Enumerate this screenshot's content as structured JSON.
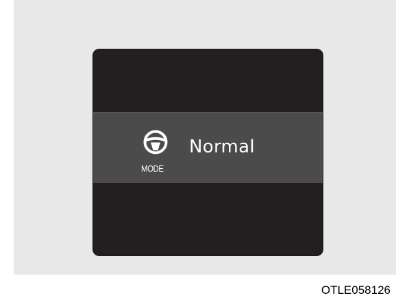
{
  "display": {
    "mode_label": "MODE",
    "mode_value": "Normal",
    "icon": "steering-wheel-icon"
  },
  "caption": "OTLE058126",
  "colors": {
    "screen": "#231f20",
    "band": "#4b4b4b",
    "text": "#ffffff",
    "background": "#e8e8e8"
  }
}
